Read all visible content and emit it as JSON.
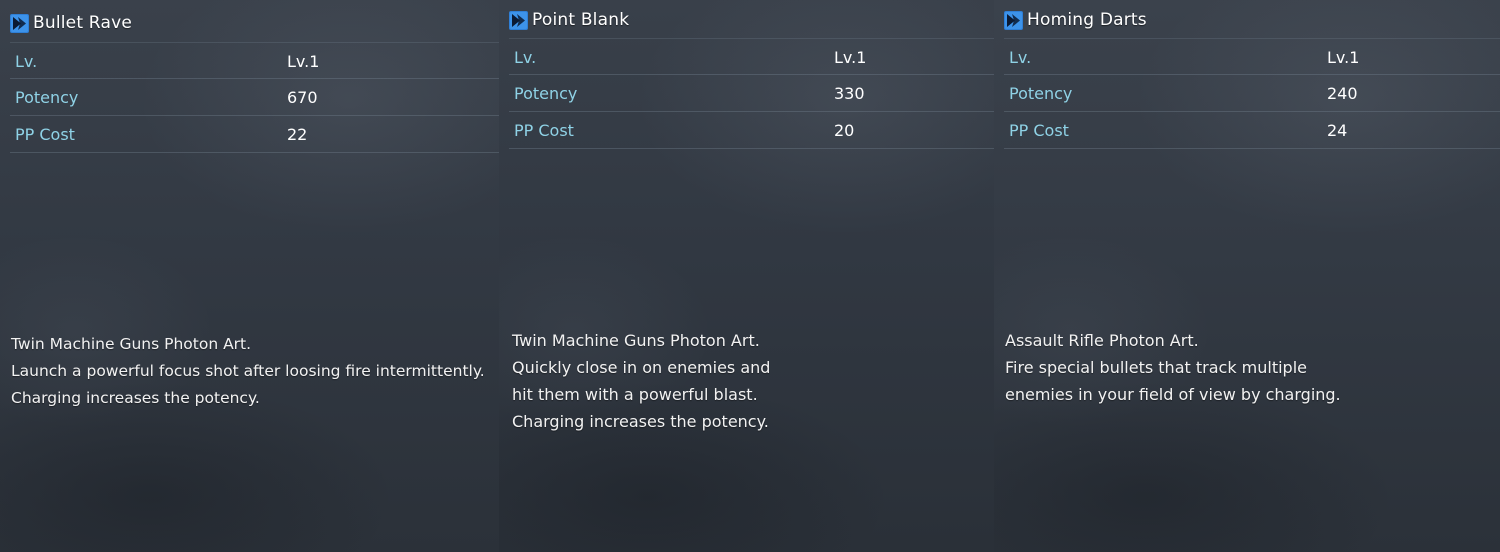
{
  "panels": [
    {
      "title": "Bullet Rave",
      "icon": "photon-art-icon",
      "stats": [
        {
          "label": "Lv.",
          "value": "Lv.1"
        },
        {
          "label": "Potency",
          "value": "670"
        },
        {
          "label": "PP Cost",
          "value": "22"
        }
      ],
      "description": [
        "Twin Machine Guns Photon Art.",
        "Launch a powerful focus shot after loosing fire intermittently.",
        "Charging increases the potency."
      ]
    },
    {
      "title": "Point Blank",
      "icon": "photon-art-icon",
      "stats": [
        {
          "label": "Lv.",
          "value": "Lv.1"
        },
        {
          "label": "Potency",
          "value": "330"
        },
        {
          "label": "PP Cost",
          "value": "20"
        }
      ],
      "description": [
        "Twin Machine Guns Photon Art.",
        "Quickly close in on enemies and",
        "hit them with a powerful blast.",
        "Charging increases the potency."
      ]
    },
    {
      "title": "Homing Darts",
      "icon": "photon-art-icon",
      "stats": [
        {
          "label": "Lv.",
          "value": "Lv.1"
        },
        {
          "label": "Potency",
          "value": "240"
        },
        {
          "label": "PP Cost",
          "value": "24"
        }
      ],
      "description": [
        "Assault Rifle Photon Art.",
        "Fire special bullets that track multiple",
        "enemies in your field of view by charging."
      ]
    }
  ],
  "colors": {
    "label": "#8fd2e6",
    "value": "#ffffff",
    "icon_bg": "#2f7fd6",
    "icon_fg": "#0b1a33"
  }
}
